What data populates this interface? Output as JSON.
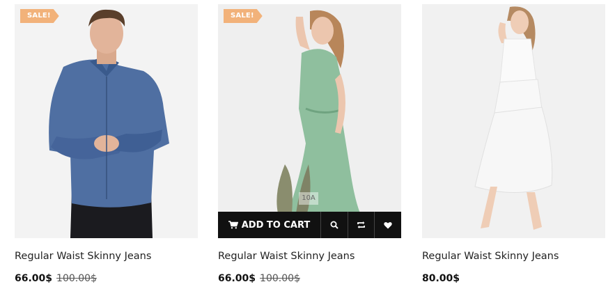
{
  "products": [
    {
      "sale_badge": "SALE!",
      "title": "Regular Waist Skinny Jeans",
      "price": "66.00$",
      "old_price": "100.00$"
    },
    {
      "sale_badge": "SALE!",
      "title": "Regular Waist Skinny Jeans",
      "price": "66.00$",
      "old_price": "100.00$",
      "add_to_cart_label": "ADD TO CART",
      "image_tag_text": "10A"
    },
    {
      "title": "Regular Waist Skinny Jeans",
      "price": "80.00$"
    }
  ],
  "icons": {
    "cart": "cart-icon",
    "quick_view": "search-icon",
    "compare": "compare-icon",
    "wishlist": "heart-icon"
  },
  "colors": {
    "sale_badge": "#f2b27a",
    "action_bar": "#111111",
    "image_bg": "#efefef"
  }
}
